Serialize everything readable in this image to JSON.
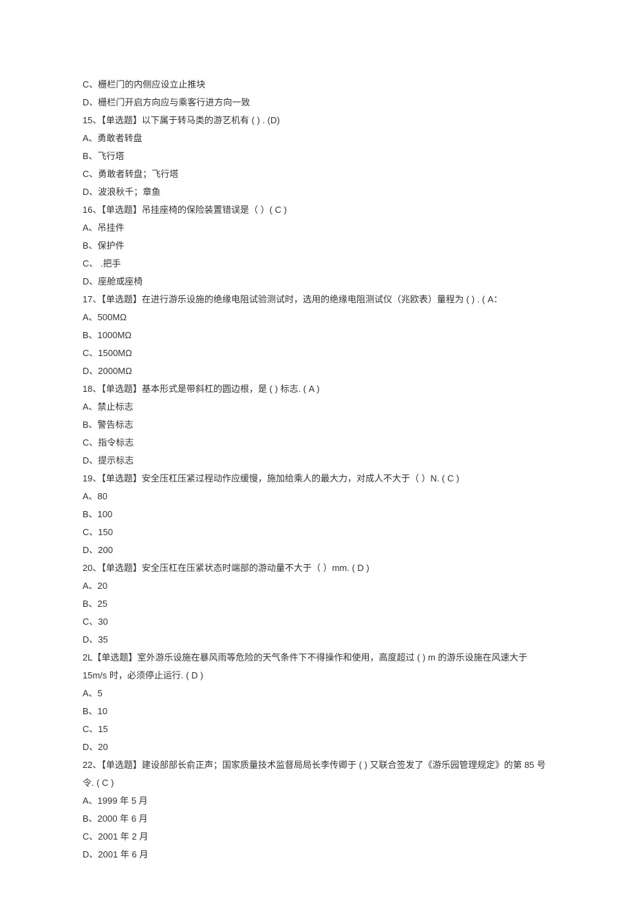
{
  "lines": [
    "C、栅栏门的内侧应设立止推块",
    "D、栅栏门开启方向应与乘客行进方向一致",
    "15、【单选题】以下属于转马类的游艺机有 (   ) . (D)",
    "A、勇敢者转盘",
    "B、飞行塔",
    "C、勇敢者转盘；飞行塔",
    "D、波浪秋千；章鱼",
    "16、【单选题】吊挂座椅的保险装置错误是（ ）( C )",
    "A、吊挂件",
    "B、保护件",
    "C、 .把手",
    "D、座舱或座椅",
    "17、【单选题】在进行游乐设施的绝缘电阻试验测试时，选用的绝缘电阻测试仪（兆欧表）量程为 ( ) . ( A：",
    "A、500MΩ",
    "B、1000MΩ",
    "C、1500MΩ",
    "D、2000MΩ",
    "18、【单选题】基本形式是带斜杠的圆边根，是 (  ) 标志. ( A )",
    "A、禁止标志",
    "B、警告标志",
    "C、指令标志",
    "D、提示标志",
    "19、【单选题】安全压杠压紧过程动作应缓慢，施加给乘人的最大力，对成人不大于（ ）N. ( C )",
    "A、80",
    "B、100",
    "C、150",
    "D、200",
    "20、【单选题】安全压杠在压紧状态时端部的游动量不大于（ ）mm. ( D )",
    "A、20",
    "B、25",
    "C、30",
    "D、35",
    "2L【单选题】室外游乐设施在暴风雨等危险的天气条件下不得操作和使用，高度超过 (  )  m 的游乐设施在风速大于 15m/s 时，必须停止运行. ( D )",
    "A、5",
    "B、10",
    "C、15",
    "D、20",
    "22、【单选题】建设部部长俞正声；国家质量技术监督局局长李传卿于 (  ) 又联合签发了《游乐园管理规定》的第 85 号令. ( C )",
    "A、1999 年 5 月",
    "B、2000 年 6 月",
    "C、2001 年 2 月",
    "D、2001 年 6 月"
  ]
}
